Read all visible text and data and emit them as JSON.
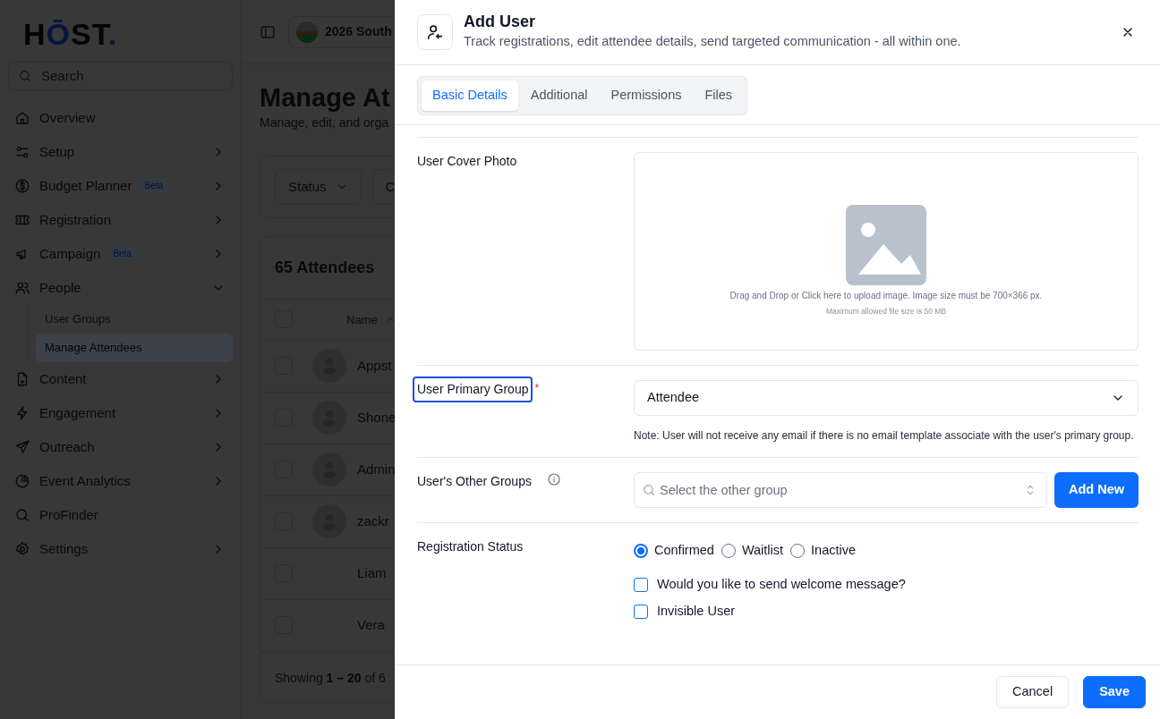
{
  "background": {
    "logo": [
      {
        "text": "H",
        "accent": false
      },
      {
        "text": "Ō",
        "accent": true
      },
      {
        "text": "ST",
        "accent": false
      },
      {
        "text": ".",
        "accent": true
      }
    ],
    "search": {
      "placeholder": "Search"
    },
    "nav": [
      {
        "label": "Overview",
        "kind": "link"
      },
      {
        "label": "Setup",
        "kind": "expandable",
        "expanded": false
      },
      {
        "label": "Budget Planner",
        "kind": "expandable",
        "expanded": false,
        "badge": "Beta"
      },
      {
        "label": "Registration",
        "kind": "expandable",
        "expanded": false
      },
      {
        "label": "Campaign",
        "kind": "expandable",
        "expanded": false,
        "badge": "Beta"
      },
      {
        "label": "People",
        "kind": "expandable",
        "expanded": true,
        "children": [
          {
            "label": "User Groups",
            "selected": false
          },
          {
            "label": "Manage Attendees",
            "selected": true
          }
        ]
      },
      {
        "label": "Content",
        "kind": "expandable",
        "expanded": false
      },
      {
        "label": "Engagement",
        "kind": "expandable",
        "expanded": false
      },
      {
        "label": "Outreach",
        "kind": "expandable",
        "expanded": false
      },
      {
        "label": "Event Analytics",
        "kind": "expandable",
        "expanded": false
      },
      {
        "label": "ProFinder",
        "kind": "link"
      },
      {
        "label": "Settings",
        "kind": "expandable",
        "expanded": false
      }
    ],
    "event": "2026 South",
    "page_title": "Manage At",
    "page_subtitle": "Manage, edit, and orga",
    "filters": [
      "Status",
      "C"
    ],
    "list_title": "65 Attendees",
    "select_all_checked": false,
    "column": "Name",
    "rows": [
      {
        "name": "Appst",
        "avatar": true,
        "checked": false
      },
      {
        "name": "Shone",
        "avatar": true,
        "checked": false
      },
      {
        "name": "Admin",
        "avatar": true,
        "checked": false
      },
      {
        "name": "zackr",
        "avatar": true,
        "checked": false
      },
      {
        "name": "Liam",
        "avatar": false,
        "checked": false
      },
      {
        "name": "Vera",
        "avatar": false,
        "checked": false
      }
    ],
    "footer": "Showing **1 – 20** of 6"
  },
  "modal": {
    "title": "Add User",
    "subtitle": "Track registrations, edit attendee details, send targeted communication - all within one.",
    "tabs": [
      {
        "label": "Basic Details",
        "selected": true
      },
      {
        "label": "Additional",
        "selected": false
      },
      {
        "label": "Permissions",
        "selected": false
      },
      {
        "label": "Files",
        "selected": false
      }
    ],
    "fields": [
      {
        "kind": "upload",
        "label": "User Cover Photo",
        "hint": "Drag and Drop or Click here to upload image. Image size must be 700×366 px.",
        "subhint": "Maximum allowed file size is 50 MB"
      },
      {
        "kind": "select",
        "label": "User Primary Group",
        "required_mark": "*",
        "focused": true,
        "value": "Attendee",
        "note": "Note: User will not receive any email if there is no email template associate with the user's primary group."
      },
      {
        "kind": "multiselect",
        "label": "User's Other Groups",
        "info": true,
        "placeholder": "Select the other group",
        "button": "Add New"
      },
      {
        "kind": "radio",
        "label": "Registration Status",
        "options": [
          {
            "label": "Confirmed",
            "selected": true
          },
          {
            "label": "Waitlist",
            "selected": false
          },
          {
            "label": "Inactive",
            "selected": false
          }
        ],
        "checkboxes": [
          {
            "label": "Would you like to send welcome message?",
            "checked": false
          },
          {
            "label": "Invisible User",
            "checked": false
          }
        ]
      }
    ],
    "buttons": [
      {
        "label": "Cancel",
        "kind": "secondary"
      },
      {
        "label": "Save",
        "kind": "primary"
      }
    ]
  }
}
